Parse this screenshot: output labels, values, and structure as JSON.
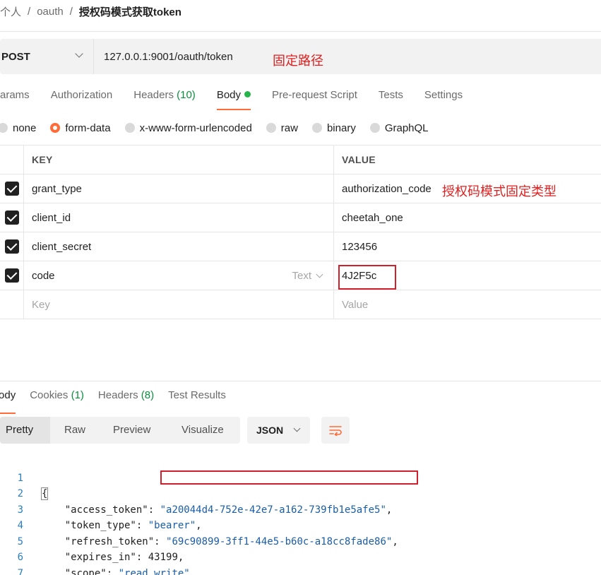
{
  "breadcrumb": {
    "items": [
      "个人",
      "oauth"
    ],
    "separator": "/",
    "current": "授权码模式获取token"
  },
  "request": {
    "method": "POST",
    "url": "127.0.0.1:9001/oauth/token"
  },
  "annotations": {
    "url_note": "固定路径",
    "grant_type_note": "授权码模式固定类型"
  },
  "request_tabs": [
    {
      "label": "Params",
      "count": ""
    },
    {
      "label": "Authorization",
      "count": ""
    },
    {
      "label": "Headers",
      "count": "(10)"
    },
    {
      "label": "Body",
      "count": ""
    },
    {
      "label": "Pre-request Script",
      "count": ""
    },
    {
      "label": "Tests",
      "count": ""
    },
    {
      "label": "Settings",
      "count": ""
    }
  ],
  "body_types": [
    "none",
    "form-data",
    "x-www-form-urlencoded",
    "raw",
    "binary",
    "GraphQL"
  ],
  "body_type_selected": "form-data",
  "params_table": {
    "headers": {
      "key": "KEY",
      "value": "VALUE"
    },
    "rows": [
      {
        "key": "grant_type",
        "value": "authorization_code",
        "checked": true
      },
      {
        "key": "client_id",
        "value": "cheetah_one",
        "checked": true
      },
      {
        "key": "client_secret",
        "value": "123456",
        "checked": true
      },
      {
        "key": "code",
        "value": "4J2F5c",
        "checked": true,
        "type": "Text"
      }
    ],
    "placeholder": {
      "key": "Key",
      "value": "Value"
    }
  },
  "response_tabs": [
    {
      "label": "Body",
      "count": ""
    },
    {
      "label": "Cookies",
      "count": "(1)"
    },
    {
      "label": "Headers",
      "count": "(8)"
    },
    {
      "label": "Test Results",
      "count": ""
    }
  ],
  "view_modes": [
    "Pretty",
    "Raw",
    "Preview",
    "Visualize"
  ],
  "format": "JSON",
  "response_json": {
    "open_brace": "{",
    "close_brace": "}",
    "lines": [
      {
        "key": "\"access_token\"",
        "value": "\"a20044d4-752e-42e7-a162-739fb1e5afe5\"",
        "kind": "string"
      },
      {
        "key": "\"token_type\"",
        "value": "\"bearer\"",
        "kind": "string"
      },
      {
        "key": "\"refresh_token\"",
        "value": "\"69c90899-3ff1-44e5-b60c-a18cc8fade86\"",
        "kind": "string"
      },
      {
        "key": "\"expires_in\"",
        "value": "43199",
        "kind": "number"
      },
      {
        "key": "\"scope\"",
        "value": "\"read write\"",
        "kind": "string"
      }
    ],
    "line_numbers": [
      "1",
      "2",
      "3",
      "4",
      "5",
      "6",
      "7"
    ]
  },
  "colors": {
    "accent": "#ff6c37",
    "count_green": "#0a8f3e",
    "annotation_red": "#e02020",
    "json_string": "#1a5da8"
  }
}
